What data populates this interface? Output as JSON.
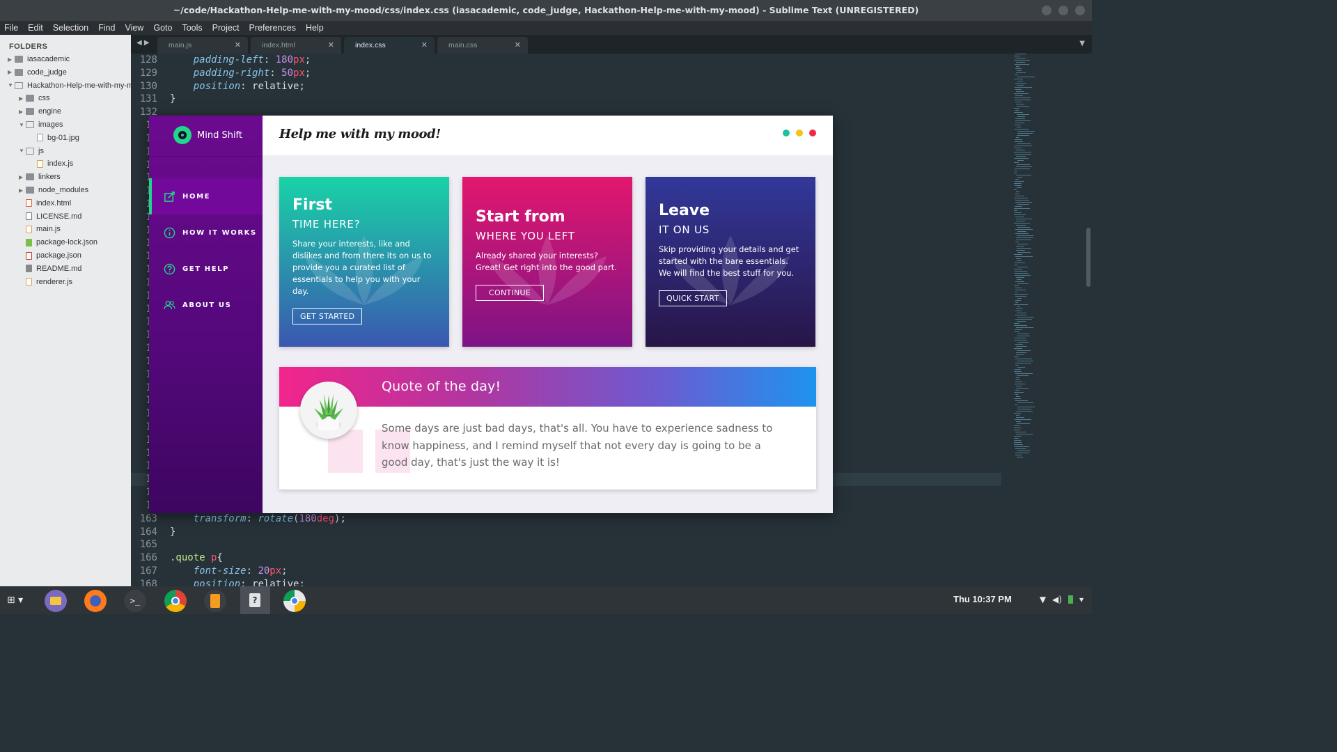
{
  "window": {
    "title": "~/code/Hackathon-Help-me-with-my-mood/css/index.css (iasacademic, code_judge, Hackathon-Help-me-with-my-mood) - Sublime Text (UNREGISTERED)"
  },
  "menu": [
    "File",
    "Edit",
    "Selection",
    "Find",
    "View",
    "Goto",
    "Tools",
    "Project",
    "Preferences",
    "Help"
  ],
  "sidebar": {
    "title": "FOLDERS",
    "items": [
      {
        "label": "iasacademic",
        "type": "folder",
        "depth": 0,
        "expanded": false
      },
      {
        "label": "code_judge",
        "type": "folder",
        "depth": 0,
        "expanded": false
      },
      {
        "label": "Hackathon-Help-me-with-my-mood",
        "type": "folder",
        "depth": 0,
        "expanded": true
      },
      {
        "label": "css",
        "type": "folder",
        "depth": 1,
        "expanded": false
      },
      {
        "label": "engine",
        "type": "folder",
        "depth": 1,
        "expanded": false
      },
      {
        "label": "images",
        "type": "folder",
        "depth": 1,
        "expanded": true
      },
      {
        "label": "bg-01.jpg",
        "type": "file",
        "depth": 2
      },
      {
        "label": "js",
        "type": "folder",
        "depth": 1,
        "expanded": true
      },
      {
        "label": "index.js",
        "type": "file-js",
        "depth": 2
      },
      {
        "label": "linkers",
        "type": "folder",
        "depth": 1,
        "expanded": false
      },
      {
        "label": "node_modules",
        "type": "folder",
        "depth": 1,
        "expanded": false
      },
      {
        "label": "index.html",
        "type": "file-html",
        "depth": 1
      },
      {
        "label": "LICENSE.md",
        "type": "file-md",
        "depth": 1
      },
      {
        "label": "main.js",
        "type": "file-js",
        "depth": 1
      },
      {
        "label": "package-lock.json",
        "type": "file-lock",
        "depth": 1
      },
      {
        "label": "package.json",
        "type": "file-json",
        "depth": 1
      },
      {
        "label": "README.md",
        "type": "file-readme",
        "depth": 1
      },
      {
        "label": "renderer.js",
        "type": "file-js",
        "depth": 1
      }
    ]
  },
  "tabs": [
    {
      "label": "main.js",
      "active": false
    },
    {
      "label": "index.html",
      "active": false
    },
    {
      "label": "index.css",
      "active": true
    },
    {
      "label": "main.css",
      "active": false
    }
  ],
  "editor": {
    "lines": [
      {
        "n": "128",
        "indent": 1,
        "prop": "padding-left",
        "num": "180",
        "unit": "px"
      },
      {
        "n": "129",
        "indent": 1,
        "prop": "padding-right",
        "num": "50",
        "unit": "px"
      },
      {
        "n": "130",
        "indent": 1,
        "prop": "position",
        "word": "relative"
      },
      {
        "n": "131",
        "indent": 0,
        "raw": "}"
      },
      {
        "n": "132",
        "indent": 0,
        "raw": ""
      },
      {
        "n": "13",
        "indent": 0,
        "raw": ""
      },
      {
        "n": "13",
        "indent": 0,
        "raw": ""
      },
      {
        "n": "13",
        "indent": 0,
        "raw": ""
      },
      {
        "n": "13",
        "indent": 0,
        "raw": ""
      },
      {
        "n": "13",
        "indent": 0,
        "raw": ""
      },
      {
        "n": "13",
        "indent": 0,
        "raw": ""
      },
      {
        "n": "13",
        "indent": 0,
        "raw": ""
      },
      {
        "n": "14",
        "indent": 0,
        "raw": ""
      },
      {
        "n": "14",
        "indent": 0,
        "raw": ""
      },
      {
        "n": "14",
        "indent": 0,
        "raw": ""
      },
      {
        "n": "14",
        "indent": 0,
        "raw": ""
      },
      {
        "n": "14",
        "indent": 0,
        "raw": ""
      },
      {
        "n": "14",
        "indent": 0,
        "raw": ""
      },
      {
        "n": "14",
        "indent": 0,
        "raw": ""
      },
      {
        "n": "14",
        "indent": 0,
        "raw": ""
      },
      {
        "n": "14",
        "indent": 0,
        "raw": ""
      },
      {
        "n": "14",
        "indent": 0,
        "raw": ""
      },
      {
        "n": "15",
        "indent": 0,
        "raw": ""
      },
      {
        "n": "15",
        "indent": 0,
        "raw": ""
      },
      {
        "n": "15",
        "indent": 0,
        "raw": ""
      },
      {
        "n": "15",
        "indent": 0,
        "raw": ""
      },
      {
        "n": "15",
        "indent": 0,
        "raw": ""
      },
      {
        "n": "15",
        "indent": 0,
        "raw": ""
      },
      {
        "n": "15",
        "indent": 0,
        "raw": ""
      },
      {
        "n": "15",
        "indent": 0,
        "raw": ""
      },
      {
        "n": "15",
        "indent": 0,
        "raw": ""
      },
      {
        "n": "15",
        "indent": 0,
        "raw": ""
      },
      {
        "n": "16",
        "indent": 0,
        "raw": "",
        "highlight": true
      },
      {
        "n": "16",
        "indent": 0,
        "raw": ""
      },
      {
        "n": "16",
        "indent": 0,
        "raw": ""
      },
      {
        "n": "163",
        "indent": 1,
        "prop": "transform",
        "func": "rotate",
        "num": "180",
        "unit": "deg"
      },
      {
        "n": "164",
        "indent": 0,
        "raw": "}"
      },
      {
        "n": "165",
        "indent": 0,
        "raw": ""
      },
      {
        "n": "166",
        "indent": 0,
        "selector": ".quote",
        "tag": "p",
        "raw": "{"
      },
      {
        "n": "167",
        "indent": 1,
        "prop": "font-size",
        "num": "20",
        "unit": "px"
      },
      {
        "n": "168",
        "indent": 1,
        "prop": "position",
        "word": "relative"
      }
    ]
  },
  "app": {
    "brand": "Mind Shift",
    "title": "Help me with my mood!",
    "nav": [
      {
        "label": "HOME",
        "icon": "edit-square-icon",
        "active": true
      },
      {
        "label": "HOW IT WORKS",
        "icon": "info-circle-icon",
        "active": false
      },
      {
        "label": "GET HELP",
        "icon": "question-circle-icon",
        "active": false
      },
      {
        "label": "ABOUT US",
        "icon": "users-icon",
        "active": false
      }
    ],
    "dots": [
      "#1fbfa4",
      "#f2c31b",
      "#f0294a"
    ],
    "cards": [
      {
        "title": "First",
        "subtitle": "TIME HERE?",
        "text": "Share your interests, like and dislikes and from there its on us to provide you a curated list of essentials to help you with your day.",
        "button": "GET STARTED",
        "gradient_top": "#19d3a7",
        "gradient_bottom": "#3a57b0"
      },
      {
        "title": "Start from",
        "subtitle": "WHERE YOU LEFT",
        "text": "Already shared your interests? Great! Get right into the good part.",
        "button": "CONTINUE",
        "gradient_top": "#e3176e",
        "gradient_bottom": "#7d1485"
      },
      {
        "title": "Leave",
        "subtitle": "IT ON US",
        "text": "Skip providing your details and get started with the bare essentials. We will find the best stuff for you.",
        "button": "QUICK START",
        "gradient_top": "#32389a",
        "gradient_bottom": "#281548"
      }
    ],
    "quote": {
      "title": "Quote of the day!",
      "text": "Some days are just bad days, that's all. You have to experience sadness to know happiness, and I remind myself that not every day is going to be a good day, that's just the way it is!"
    }
  },
  "taskbar": {
    "clock": "Thu 10:37 PM",
    "apps": [
      "files-icon",
      "firefox-icon",
      "terminal-icon",
      "chrome-icon",
      "sublime-icon",
      "unknown-app-icon",
      "chromium-icon"
    ]
  }
}
